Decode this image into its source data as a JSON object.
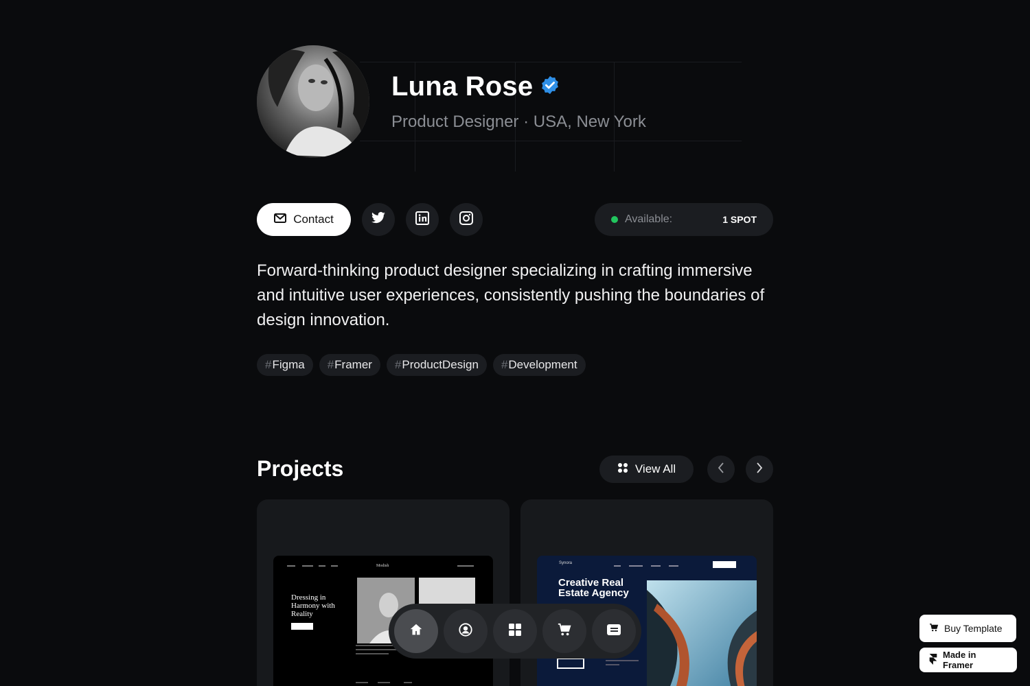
{
  "profile": {
    "name": "Luna Rose",
    "role": "Product Designer · USA, New York",
    "bio": "Forward-thinking product designer specializing in crafting immersive and intuitive user experiences, consistently pushing the boundaries of design innovation."
  },
  "actions": {
    "contact_label": "Contact",
    "socials": [
      "twitter-icon",
      "linkedin-icon",
      "instagram-icon"
    ],
    "availability_label": "Available:",
    "availability_value": "1 SPOT"
  },
  "tags": [
    {
      "hash": "#",
      "label": "Figma"
    },
    {
      "hash": "#",
      "label": "Framer"
    },
    {
      "hash": "#",
      "label": "ProductDesign"
    },
    {
      "hash": "#",
      "label": "Development"
    }
  ],
  "projects": {
    "title": "Projects",
    "view_all_label": "View All",
    "cards": [
      {
        "headline": "Dressing in Harmony with Reality",
        "brand": "Modish"
      },
      {
        "headline": "Creative Real Estate Agency",
        "brand": "Synora"
      }
    ]
  },
  "dock": [
    "home-icon",
    "profile-icon",
    "grid-icon",
    "cart-icon",
    "list-icon"
  ],
  "floating": {
    "buy_label": "Buy Template",
    "made_label": "Made in Framer"
  },
  "colors": {
    "background": "#0a0b0d",
    "surface": "#1b1d21",
    "verified": "#2f8fe6",
    "available": "#22c55e"
  }
}
